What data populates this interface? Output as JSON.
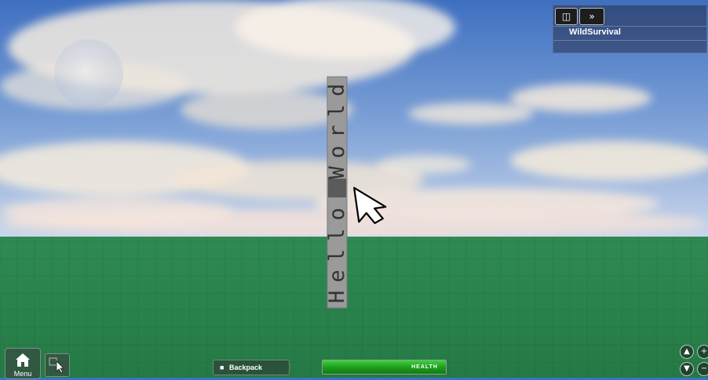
{
  "topbar": {
    "player_name": "WildSurvival",
    "console_icon": "console-icon",
    "expand_icon": "fast-forward-icon"
  },
  "pillar": {
    "letters_bottom_to_top": [
      "H",
      "e",
      "l",
      "l",
      "o",
      "",
      "W",
      "o",
      "r",
      "l",
      "d"
    ]
  },
  "hud": {
    "menu_label": "Menu",
    "backpack_label": "Backpack",
    "health_label": "HEALTH",
    "health_fraction": 1.0
  },
  "colors": {
    "sky": "#3b73c4",
    "baseplate": "#2e8b57",
    "health": "#1fb51f",
    "pillar": "#9a9a9a"
  }
}
